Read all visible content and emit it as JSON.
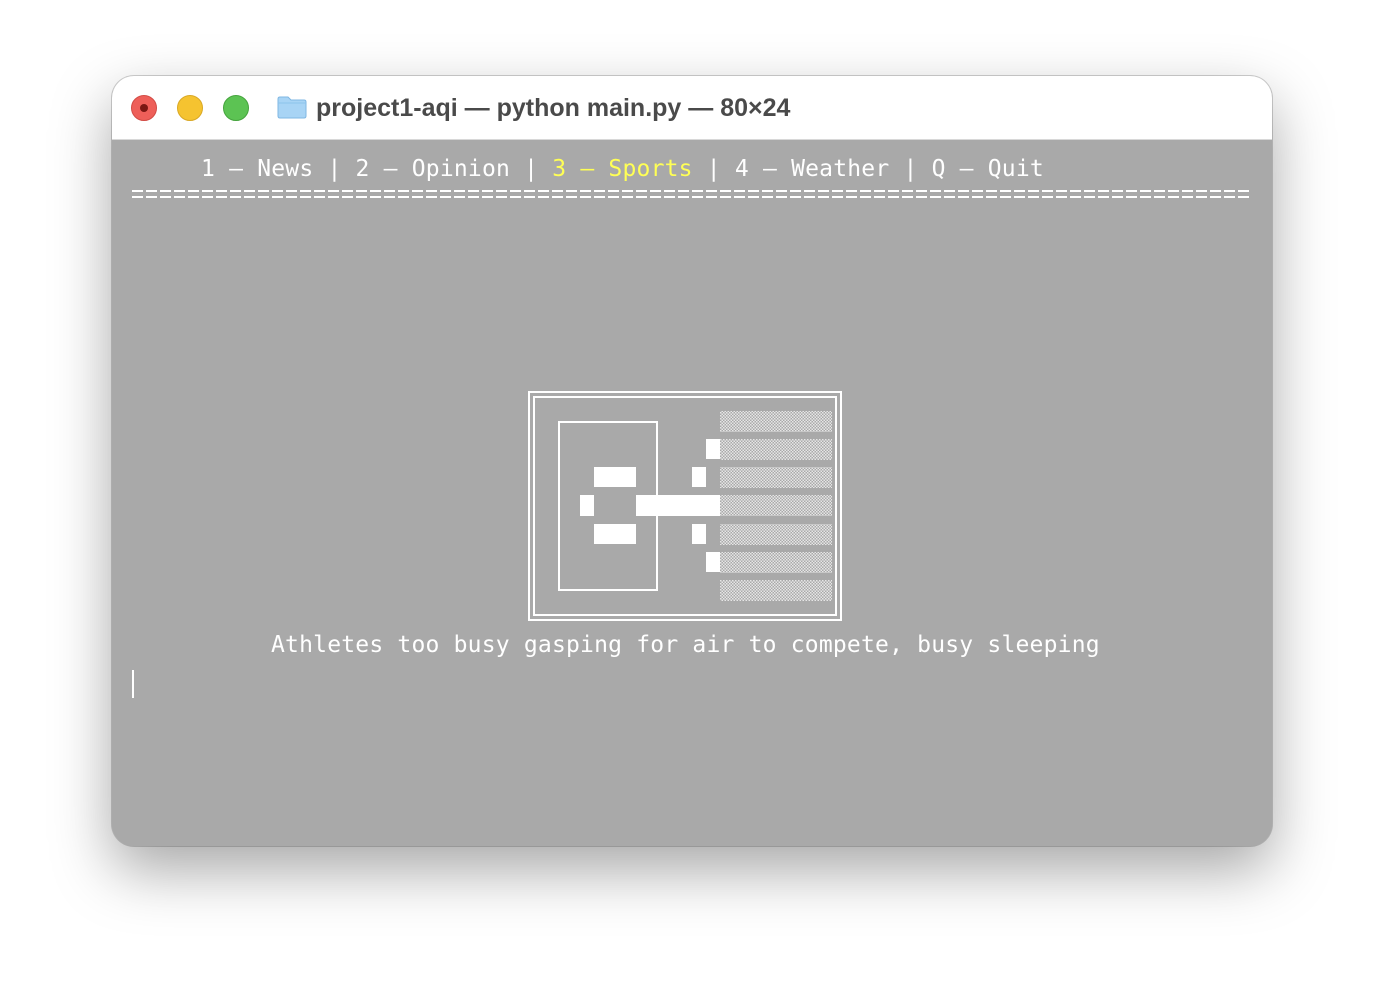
{
  "window": {
    "title": "project1-aqi — python main.py — 80×24",
    "folder_icon": "folder-icon"
  },
  "menu": {
    "items": [
      {
        "label": "1 – News"
      },
      {
        "label": "2 – Opinion"
      },
      {
        "label": "3 – Sports",
        "active": true
      },
      {
        "label": "4 – Weather"
      },
      {
        "label": "Q – Quit"
      }
    ],
    "separator": " | "
  },
  "content": {
    "art_icon": "sports-court-ascii-art",
    "caption": "Athletes too busy gasping for air to compete, busy sleeping"
  },
  "colors": {
    "terminal_bg": "#a9a9a9",
    "text": "#ffffff",
    "active_menu": "#ffff55"
  }
}
